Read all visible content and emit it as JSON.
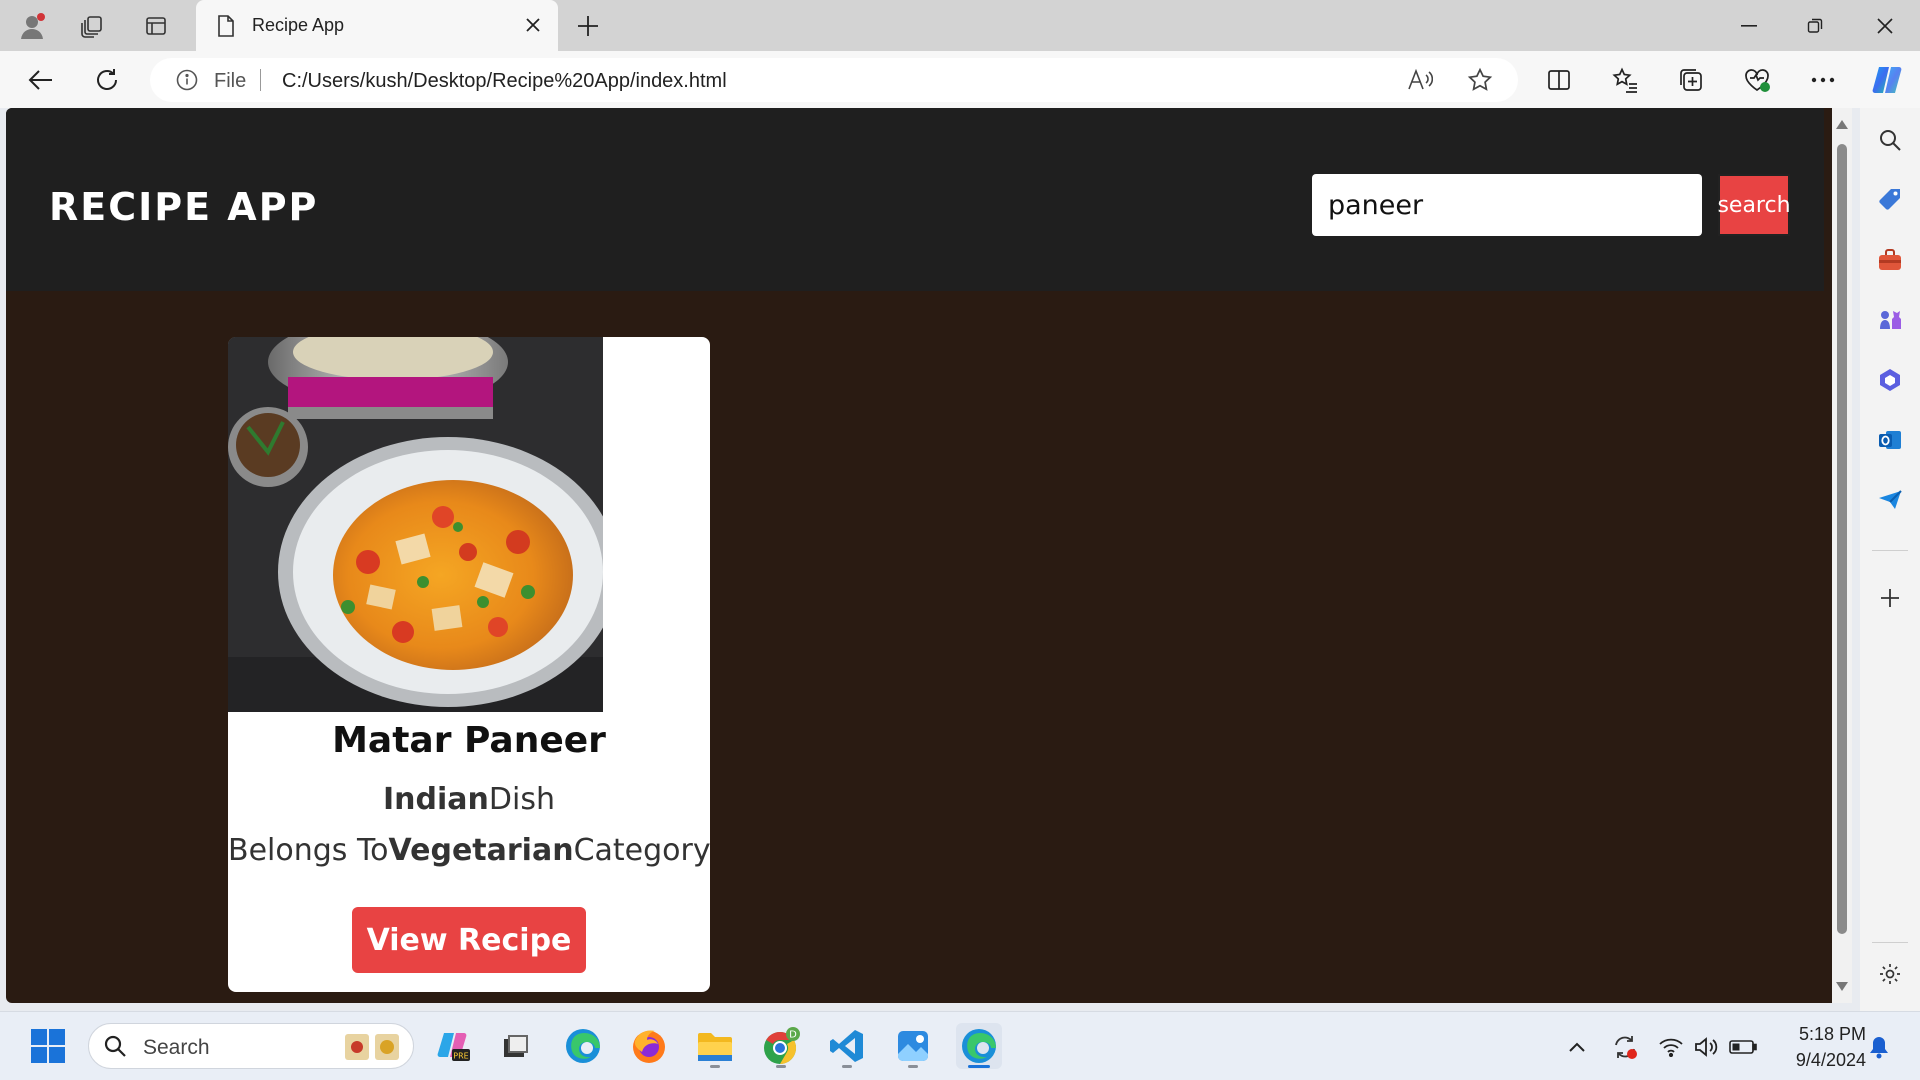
{
  "browser": {
    "tab_title": "Recipe App",
    "address_prefix": "File",
    "url": "C:/Users/kush/Desktop/Recipe%20App/index.html"
  },
  "app": {
    "title": "RECIPE APP",
    "search_value": "paneer",
    "search_button": "search"
  },
  "recipe": {
    "name": "Matar Paneer",
    "area": "Indian",
    "area_suffix": "Dish",
    "category_prefix": "Belongs To",
    "category": "Vegetarian",
    "category_suffix": "Category",
    "button": "View Recipe"
  },
  "taskbar": {
    "search_label": "Search",
    "time": "5:18 PM",
    "date": "9/4/2024"
  },
  "colors": {
    "accent": "#e84343",
    "page_bg": "#2a1b12",
    "header_bg": "#1f1f1f"
  }
}
